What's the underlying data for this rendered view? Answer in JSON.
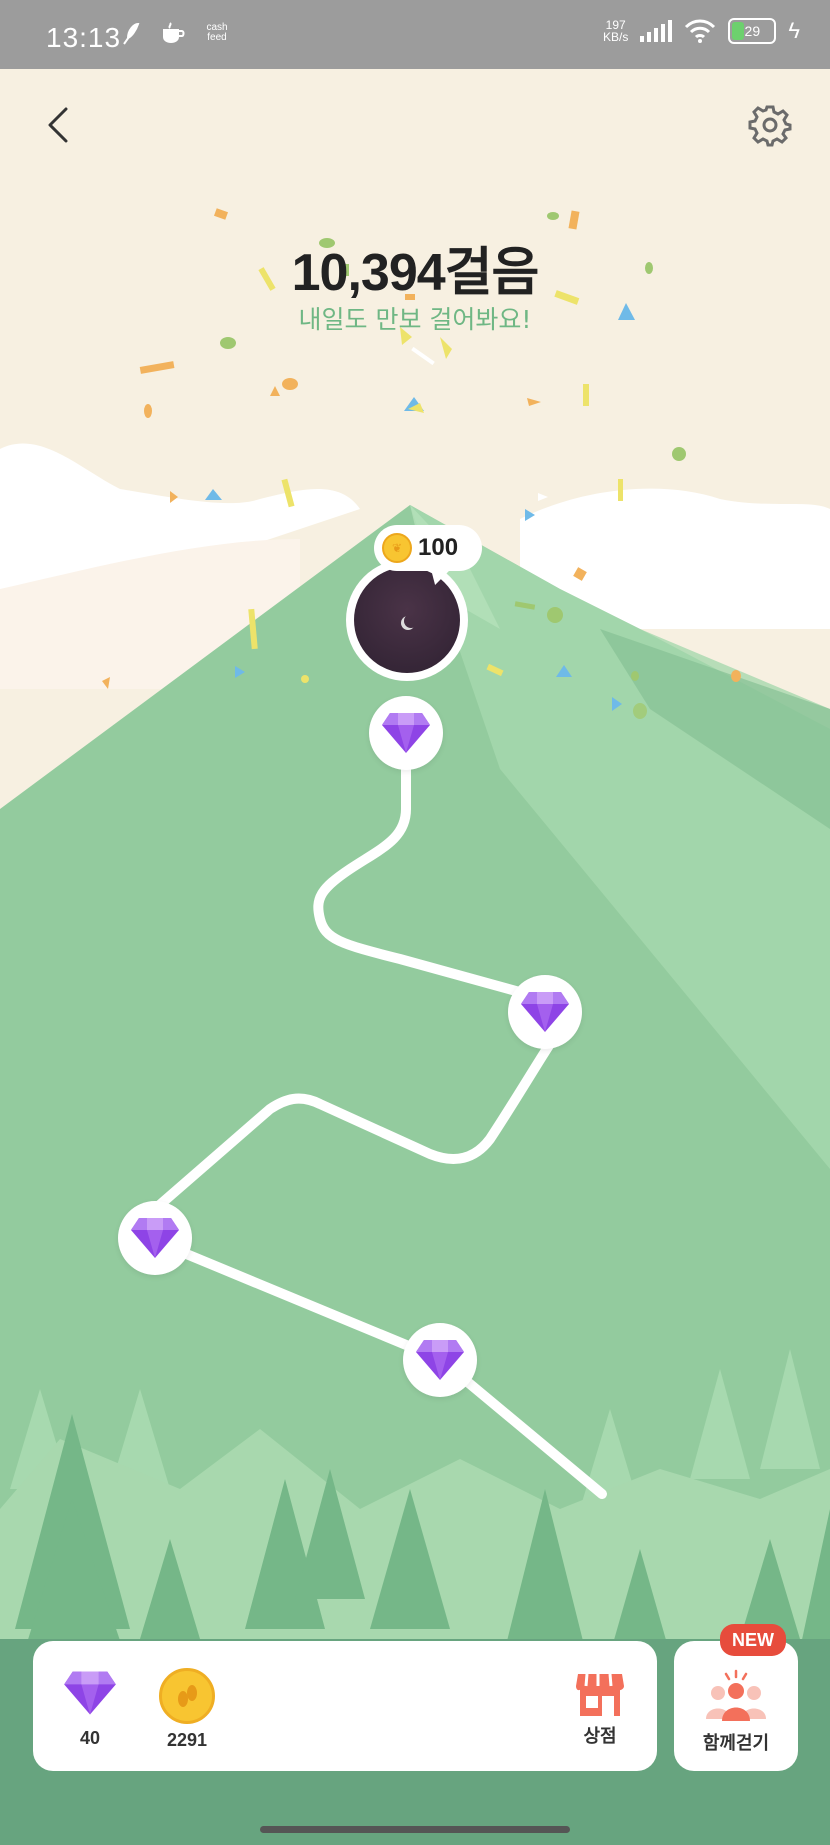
{
  "status_bar": {
    "time": "13:13",
    "app_icons": [
      "feather-icon",
      "coffee-icon",
      "cashfeed-icon"
    ],
    "cashfeed_label": "cash feed",
    "network_speed": "197",
    "network_unit": "KB/s",
    "battery": "29"
  },
  "header": {
    "back_icon": "chevron-left-icon",
    "settings_icon": "gear-icon"
  },
  "hero": {
    "steps": "10,394걸음",
    "subtitle": "내일도 만보 걸어봐요!"
  },
  "path": {
    "reward_value": "100",
    "current_node": "moon-icon",
    "milestone_icon": "diamond-icon"
  },
  "bottom_bar": {
    "gems": "40",
    "coins": "2291",
    "shop_label": "상점",
    "together_label": "함께걷기",
    "new_badge": "NEW"
  },
  "colors": {
    "background": "#F7F0E1",
    "mountain": "#93CB9E",
    "accent_green": "#6FB784",
    "gem_purple": "#8E44E6",
    "badge_red": "#E74C3C"
  }
}
